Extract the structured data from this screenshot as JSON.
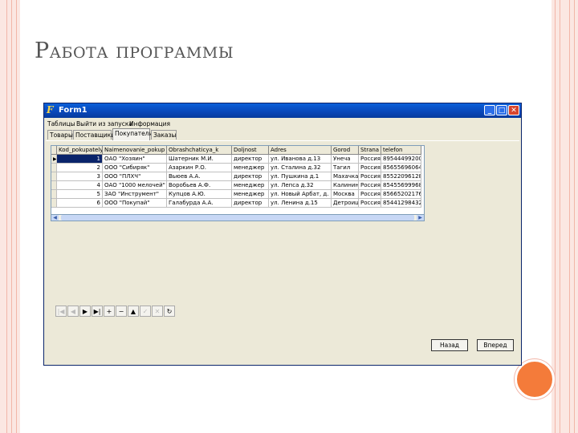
{
  "slide": {
    "title": "Работа программы"
  },
  "window": {
    "title": "Form1",
    "icon": "delphi-form-icon"
  },
  "menu": [
    "Таблицы",
    "Выйти из запуска",
    "Информация"
  ],
  "tabs": [
    {
      "label": "Товары",
      "active": false
    },
    {
      "label": "Поставщики",
      "active": false
    },
    {
      "label": "Покупатели",
      "active": true
    },
    {
      "label": "Заказы",
      "active": false
    }
  ],
  "table": {
    "columns": [
      "Kod_pokupatelya",
      "Naimenovanie_pokup",
      "Obrashchaticya_k",
      "Doljnost",
      "Adres",
      "Gorod",
      "Strana",
      "telefon"
    ],
    "rows": [
      [
        "1",
        "ОАО \"Хозяин\"",
        "Шатерник М.И.",
        "директор",
        "ул. Иванова д.13",
        "Унеча",
        "Россия",
        "89544499200"
      ],
      [
        "2",
        "ООО \"Сибиряк\"",
        "Азаркин Р.О.",
        "менеджер",
        "ул. Сталина д.32",
        "Тагил",
        "Россия",
        "85655696064"
      ],
      [
        "3",
        "ООО \"ПЛХЧ\"",
        "Вьюев А.А.",
        "директор",
        "ул. Пушкина д.1",
        "Махачкала",
        "Россия",
        "85522096128"
      ],
      [
        "4",
        "ОАО \"1000 мелочей\"",
        "Воробьев А.Ф.",
        "менеджер",
        "ул. Лепса д.32",
        "Калинингр",
        "Россия",
        "85455699968"
      ],
      [
        "5",
        "ЗАО \"Инструмент\"",
        "Купцов А.Ю.",
        "менеджер",
        "ул. Новый Арбат, д. 8",
        "Москва",
        "Россия",
        "85665202176"
      ],
      [
        "6",
        "ООО \"Покупай\"",
        "Галабурда А.А.",
        "директор",
        "ул. Ленина д.15",
        "Детроицк",
        "Россия",
        "85441298432"
      ]
    ],
    "selected_row": 0
  },
  "navigator": [
    "first",
    "prior",
    "next",
    "last",
    "insert",
    "delete",
    "edit",
    "post",
    "cancel",
    "refresh"
  ],
  "buttons": {
    "back": "Назад",
    "forward": "Вперед"
  }
}
